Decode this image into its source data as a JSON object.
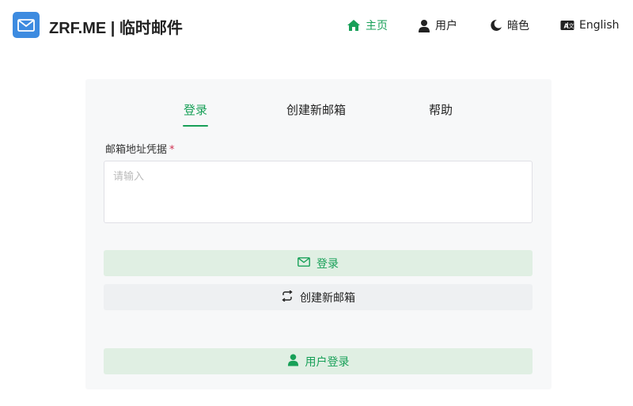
{
  "header": {
    "brand": "ZRF.ME | 临时邮件",
    "logo_icon": "mail-icon",
    "nav": {
      "home": {
        "label": "主页",
        "icon": "home-icon"
      },
      "user": {
        "label": "用户",
        "icon": "user-icon"
      },
      "dark": {
        "label": "暗色",
        "icon": "moon-icon"
      },
      "language": {
        "label": "English",
        "icon": "translate-icon"
      }
    }
  },
  "tabs": {
    "login": "登录",
    "create": "创建新邮箱",
    "help": "帮助",
    "active": "login"
  },
  "form": {
    "label": "邮箱地址凭据",
    "required_mark": "*",
    "placeholder": "请输入",
    "value": ""
  },
  "buttons": {
    "login": {
      "label": "登录",
      "icon": "mail-icon"
    },
    "create": {
      "label": "创建新邮箱",
      "icon": "refresh-arrows-icon"
    },
    "user_login": {
      "label": "用户登录",
      "icon": "user-icon"
    }
  },
  "colors": {
    "accent": "#18a058",
    "logo_bg": "#3d8be0",
    "card_bg": "#f7f8f9",
    "primary_btn_bg": "#e0efe3",
    "secondary_btn_bg": "#eef0f2",
    "required": "#d03050"
  }
}
